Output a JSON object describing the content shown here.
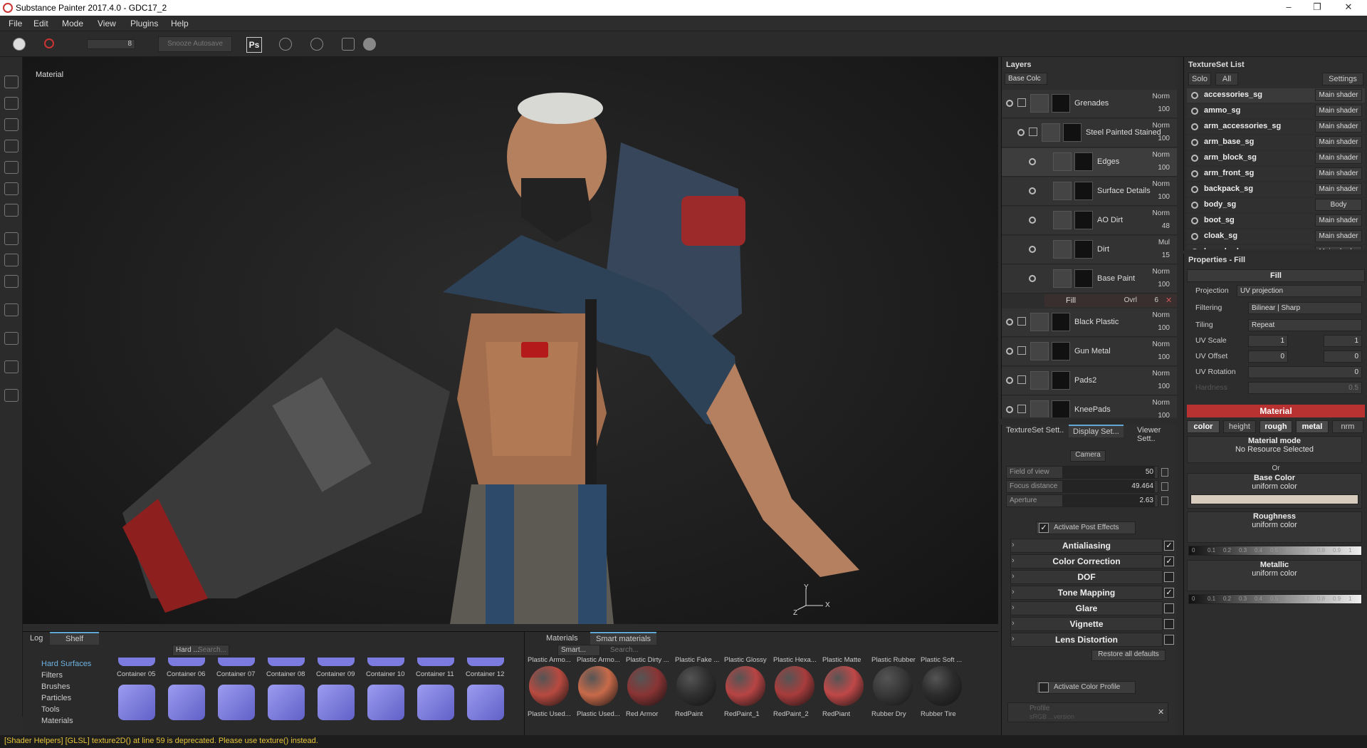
{
  "window": {
    "title": "Substance Painter 2017.4.0 - GDC17_2",
    "minimize": "–",
    "maximize": "❐",
    "close": "✕"
  },
  "menu": [
    "File",
    "Edit",
    "Mode",
    "View",
    "Plugins",
    "Help"
  ],
  "toolbar": {
    "brush_size": "8",
    "snooze": "Snooze Autosave",
    "ps": "Ps"
  },
  "viewport": {
    "label": "Material",
    "axis_y": "Y",
    "axis_z": "Z",
    "axis_x": "X"
  },
  "layers": {
    "title": "Layers",
    "channel": "Base Colc",
    "rows": [
      {
        "name": "Grenades",
        "blend": "Norm",
        "opacity": "100"
      },
      {
        "name": "Steel Painted Stained",
        "blend": "Norm",
        "opacity": "100"
      },
      {
        "name": "Edges",
        "blend": "Norm",
        "opacity": "100"
      },
      {
        "name": "Surface Details",
        "blend": "Norm",
        "opacity": "100"
      },
      {
        "name": "AO Dirt",
        "blend": "Norm",
        "opacity": "48"
      },
      {
        "name": "Dirt",
        "blend": "Mul",
        "opacity": "15"
      },
      {
        "name": "Base Paint",
        "blend": "Norm",
        "opacity": "100"
      },
      {
        "name": "Black Plastic",
        "blend": "Norm",
        "opacity": "100"
      },
      {
        "name": "Gun Metal",
        "blend": "Norm",
        "opacity": "100"
      },
      {
        "name": "Pads2",
        "blend": "Norm",
        "opacity": "100"
      },
      {
        "name": "KneePads",
        "blend": "Norm",
        "opacity": "100"
      }
    ],
    "fill": {
      "name": "Fill",
      "blend": "Ovrl",
      "value": "6"
    }
  },
  "display": {
    "tabs": [
      "TextureSet Sett..",
      "Display Set...",
      "Viewer Sett.."
    ],
    "camera": "Camera",
    "sliders": [
      {
        "label": "Field of view",
        "value": "50"
      },
      {
        "label": "Focus distance",
        "value": "49.464"
      },
      {
        "label": "Aperture",
        "value": "2.63"
      }
    ],
    "post_effects": "Activate Post Effects",
    "sections": [
      {
        "label": "Antialiasing",
        "on": true
      },
      {
        "label": "Color Correction",
        "on": true
      },
      {
        "label": "DOF",
        "on": false
      },
      {
        "label": "Tone Mapping",
        "on": true
      },
      {
        "label": "Glare",
        "on": false
      },
      {
        "label": "Vignette",
        "on": false
      },
      {
        "label": "Lens Distortion",
        "on": false
      }
    ],
    "restore": "Restore all defaults",
    "color_profile": "Activate Color Profile",
    "profile": "Profile",
    "profile_value": "sRGB ...version"
  },
  "textureset": {
    "title": "TextureSet List",
    "solo": "Solo",
    "all": "All",
    "settings": "Settings",
    "rows": [
      {
        "name": "accessories_sg",
        "shader": "Main shader"
      },
      {
        "name": "ammo_sg",
        "shader": "Main shader"
      },
      {
        "name": "arm_accessories_sg",
        "shader": "Main shader"
      },
      {
        "name": "arm_base_sg",
        "shader": "Main shader"
      },
      {
        "name": "arm_block_sg",
        "shader": "Main shader"
      },
      {
        "name": "arm_front_sg",
        "shader": "Main shader"
      },
      {
        "name": "backpack_sg",
        "shader": "Main shader"
      },
      {
        "name": "body_sg",
        "shader": "Body"
      },
      {
        "name": "boot_sg",
        "shader": "Main shader"
      },
      {
        "name": "cloak_sg",
        "shader": "Main shader"
      },
      {
        "name": "lowerbody_sg",
        "shader": "Main shader"
      }
    ]
  },
  "props": {
    "title": "Properties - Fill",
    "fill": "Fill",
    "projection_label": "Projection",
    "projection": "UV projection",
    "filtering_label": "Filtering",
    "filtering": "Bilinear | Sharp",
    "tiling_label": "Tiling",
    "tiling": "Repeat",
    "uvscale_label": "UV Scale",
    "uvscale": "1",
    "uvscale2": "1",
    "uvoffset_label": "UV Offset",
    "uvoffset": "0",
    "uvoffset2": "0",
    "uvrot_label": "UV Rotation",
    "uvrot": "0",
    "hardness_label": "Hardness",
    "hardness": "0.5",
    "material": "Material",
    "channels": [
      "color",
      "height",
      "rough",
      "metal",
      "nrm"
    ],
    "matmode": "Material mode",
    "noresource": "No Resource Selected",
    "or": "Or",
    "basecolor": "Base Color",
    "uniform": "uniform color",
    "roughness": "Roughness",
    "metallic": "Metallic",
    "ramp": [
      "0",
      "0.1",
      "0.2",
      "0.3",
      "0.4",
      "0.5",
      "0.6",
      "0.7",
      "0.8",
      "0.9",
      "1"
    ]
  },
  "bottom": {
    "tabs": [
      "Log",
      "Shelf"
    ],
    "shelf_filter": "Hard ...",
    "search": "Search...",
    "categories": [
      "Hard Surfaces",
      "Filters",
      "Brushes",
      "Particles",
      "Tools",
      "Materials"
    ],
    "shelf_items": [
      "Container 05",
      "Container 06",
      "Container 07",
      "Container 08",
      "Container 09",
      "Container 10",
      "Container 11",
      "Container 12"
    ],
    "mat_tabs": [
      "Materials",
      "Smart materials"
    ],
    "smart_filter": "Smart...",
    "materials": [
      {
        "name": "Plastic Used...",
        "top": "Plastic Armo...",
        "color": "#b84a40"
      },
      {
        "name": "Plastic Used...",
        "top": "Plastic Armo...",
        "color": "#c86a4a"
      },
      {
        "name": "Red Armor",
        "top": "Plastic Dirty ...",
        "color": "#8a3434"
      },
      {
        "name": "RedPaint",
        "top": "Plastic Fake ...",
        "color": "#303030"
      },
      {
        "name": "RedPaint_1",
        "top": "Plastic Glossy",
        "color": "#b84444"
      },
      {
        "name": "RedPaint_2",
        "top": "Plastic Hexa...",
        "color": "#a83c3c"
      },
      {
        "name": "RedPiant",
        "top": "Plastic Matte",
        "color": "#c04848"
      },
      {
        "name": "Rubber Dry",
        "top": "Plastic Rubber",
        "color": "#383838"
      },
      {
        "name": "Rubber Tire",
        "top": "Plastic Soft ...",
        "color": "#2c2c2c"
      }
    ]
  },
  "status": "[Shader Helpers] [GLSL] texture2D() at line 59 is deprecated. Please use texture() instead."
}
